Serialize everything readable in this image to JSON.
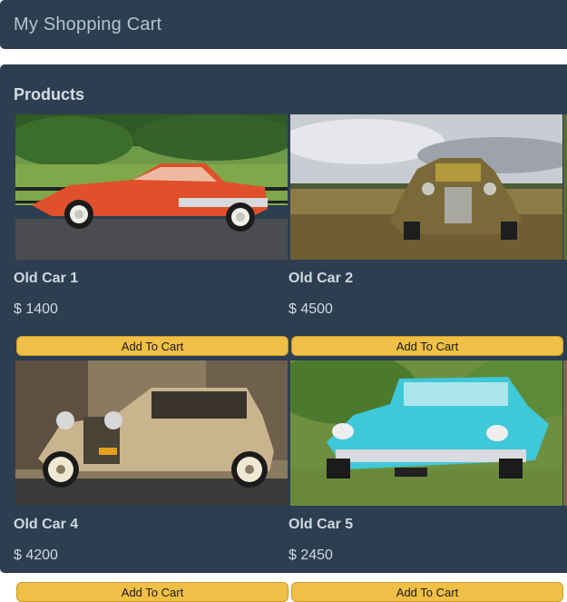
{
  "header": {
    "title": "My Shopping Cart"
  },
  "products_section": {
    "title": "Products",
    "items": [
      {
        "name": "Old Car 1",
        "price": "$ 1400",
        "button": "Add To Cart",
        "color": "#e0502a"
      },
      {
        "name": "Old Car 2",
        "price": "$ 4500",
        "button": "Add To Cart",
        "color": "#7a6a3a"
      },
      {
        "name": "Old Car 4",
        "price": "$ 4200",
        "button": "Add To Cart",
        "color": "#c9b48e"
      },
      {
        "name": "Old Car 5",
        "price": "$ 2450",
        "button": "Add To Cart",
        "color": "#3ec8d8"
      }
    ]
  },
  "colors": {
    "panel": "#2c3e50",
    "button": "#f0bf45",
    "text": "#d0d8e0"
  }
}
